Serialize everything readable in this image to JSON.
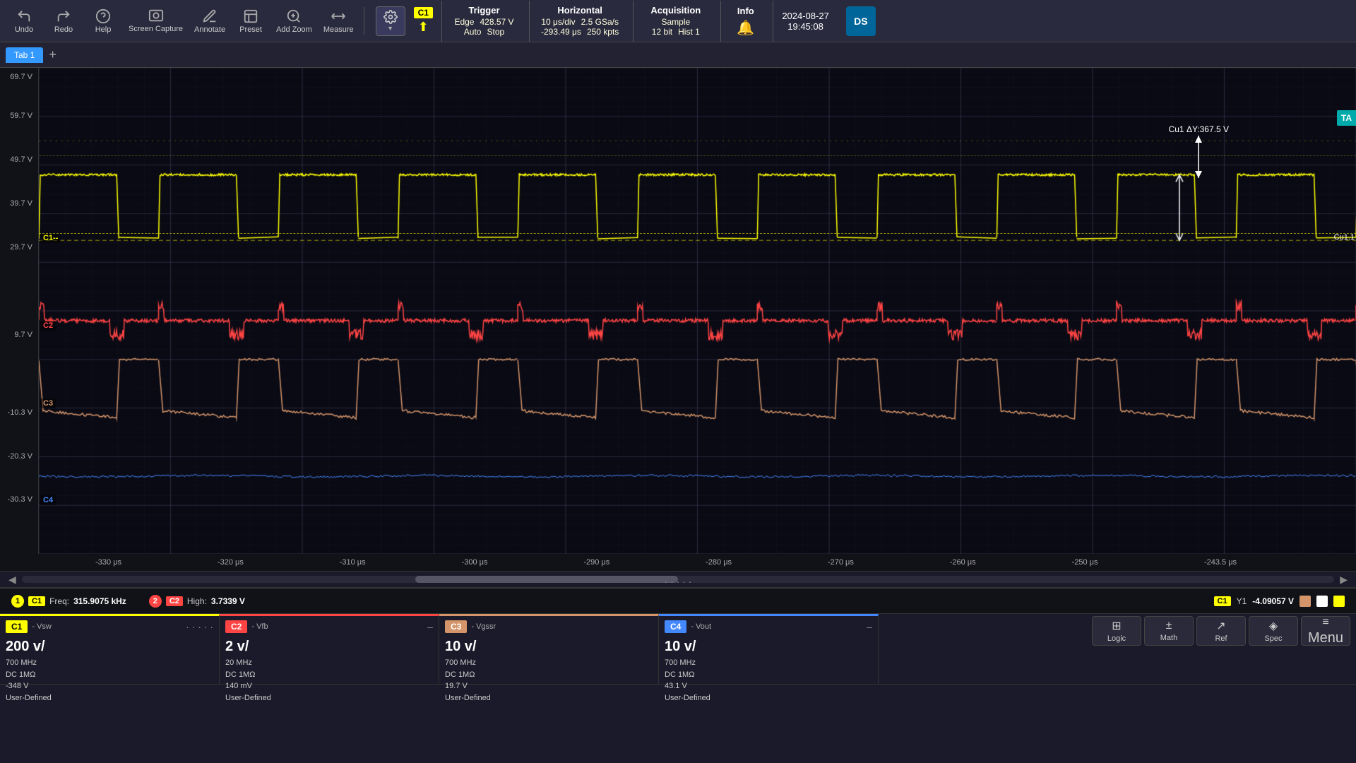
{
  "toolbar": {
    "undo_label": "Undo",
    "redo_label": "Redo",
    "help_label": "Help",
    "screen_capture_label": "Screen\nCapture",
    "annotate_label": "Annotate",
    "preset_label": "Preset",
    "add_zoom_label": "Add Zoom",
    "measure_label": "Measure"
  },
  "trigger": {
    "title": "Trigger",
    "type": "Edge",
    "voltage": "428.57 V",
    "mode": "Auto",
    "status": "Stop"
  },
  "horizontal": {
    "title": "Horizontal",
    "time_div": "10 μs/div",
    "sample_rate": "2.5 GSa/s",
    "samples": "250 kpts",
    "position": "-293.49 μs"
  },
  "acquisition": {
    "title": "Acquisition",
    "mode": "Sample",
    "bits": "12 bit",
    "hist": "Hist 1"
  },
  "info": {
    "title": "Info"
  },
  "datetime": {
    "date": "2024-08-27",
    "time": "19:45:08"
  },
  "tabs": {
    "active": "Tab 1",
    "add_symbol": "+"
  },
  "y_axis_labels": [
    {
      "value": "69.7 V",
      "pct": 1
    },
    {
      "value": "59.7 V",
      "pct": 8
    },
    {
      "value": "49.7 V",
      "pct": 19
    },
    {
      "value": "39.7 V",
      "pct": 30
    },
    {
      "value": "29.7 V",
      "pct": 40
    },
    {
      "value": "9.7 V",
      "pct": 57
    },
    {
      "value": "-10.3 V",
      "pct": 73
    },
    {
      "value": "-20.3 V",
      "pct": 83
    },
    {
      "value": "-30.3 V",
      "pct": 93
    }
  ],
  "x_axis_labels": [
    {
      "value": "-330 μs",
      "pct": 4
    },
    {
      "value": "-320 μs",
      "pct": 13
    },
    {
      "value": "-310 μs",
      "pct": 22
    },
    {
      "value": "-300 μs",
      "pct": 31
    },
    {
      "value": "-290 μs",
      "pct": 40
    },
    {
      "value": "-280 μs",
      "pct": 49
    },
    {
      "value": "-270 μs",
      "pct": 58
    },
    {
      "value": "-260 μs",
      "pct": 67
    },
    {
      "value": "-250 μs",
      "pct": 76
    },
    {
      "value": "-243.5 μs",
      "pct": 84
    }
  ],
  "channels": {
    "c1": {
      "color": "#ffff00",
      "label": "C1",
      "name": "C1 - Vsw",
      "dotted": "......",
      "setting_v": "200 v/",
      "setting_detail": "DC 1MΩ\n-348 V\nUser-Defined"
    },
    "c2": {
      "color": "#ff4444",
      "label": "C2",
      "name": "C2 - Vfb",
      "dash": "–",
      "setting_v": "2 v/",
      "setting_detail": "20 MHz\nDC 1MΩ\n140 mV\nUser-Defined"
    },
    "c3": {
      "color": "#d4956a",
      "label": "C3",
      "name": "C3 - Vgssr",
      "dash": "",
      "setting_v": "10 v/",
      "setting_detail": "700 MHz\nDC 1MΩ\n19.7 V\nUser-Defined"
    },
    "c4": {
      "color": "#4488ff",
      "label": "C4",
      "name": "C4 - Vout",
      "dash": "–",
      "setting_v": "10 v/",
      "setting_detail": "700 MHz\nDC 1MΩ\n43.1 V\nUser-Defined"
    }
  },
  "measurements": {
    "item1_num": "1",
    "item1_ch": "C1",
    "item1_label": "Freq:",
    "item1_value": "315.9075 kHz",
    "item2_num": "2",
    "item2_ch": "C2",
    "item2_label": "High:",
    "item2_value": "3.7339 V"
  },
  "cursor": {
    "ch": "C1",
    "y1_label": "Y1",
    "y1_value": "-4.09057 V",
    "delta_label": "Cu1 ΔY:367.5 V"
  },
  "bottom_buttons": {
    "logic": "Logic",
    "math": "Math",
    "ref": "Ref",
    "spec": "Spec",
    "menu": "Menu",
    "menu_icon": "≡"
  },
  "ta_label": "TA",
  "cu1_label": "Cu1.1"
}
